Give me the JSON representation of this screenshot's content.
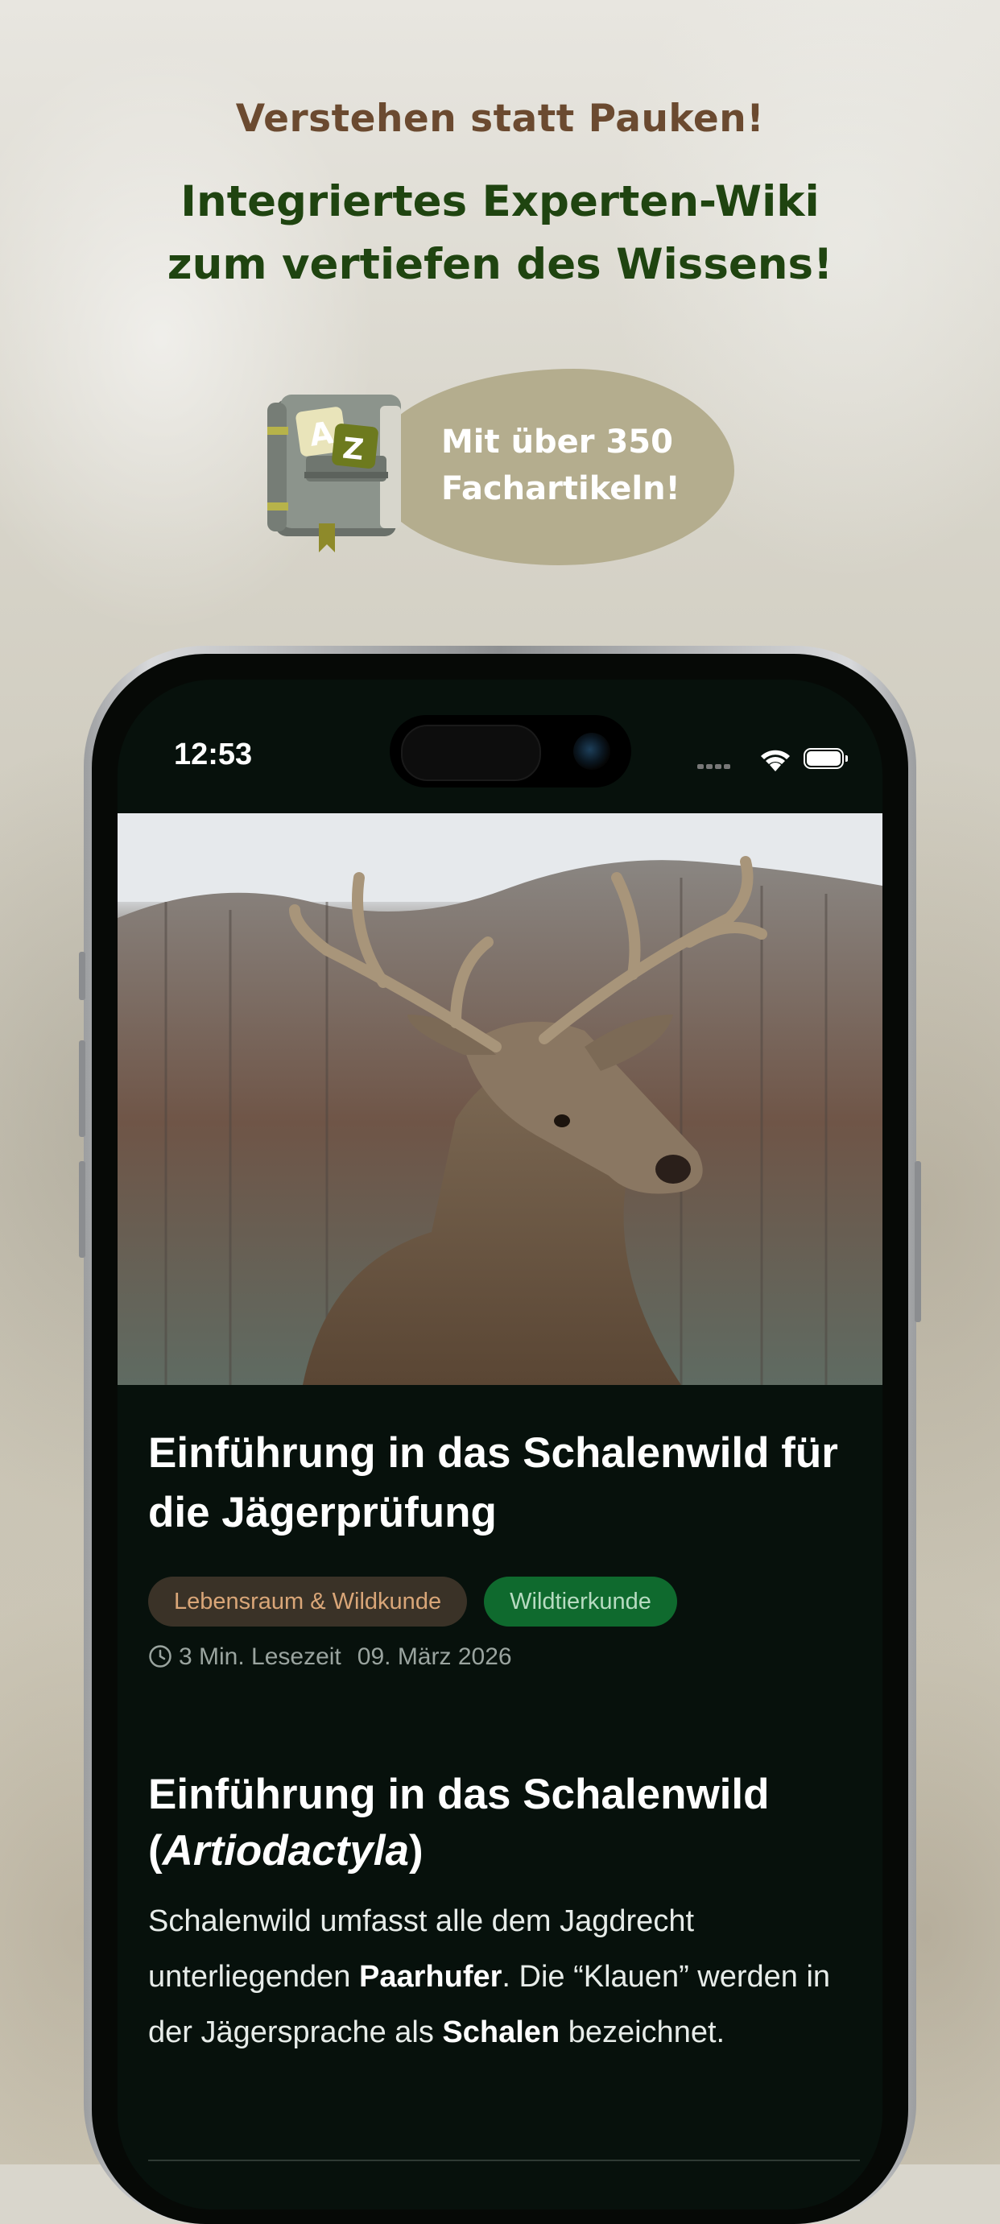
{
  "promo": {
    "subtitle": "Verstehen statt Pauken!",
    "title_line1": "Integriertes Experten-Wiki",
    "title_line2": "zum vertiefen des Wissens!",
    "bubble_line1": "Mit über 350",
    "bubble_line2": "Fachartikeln!",
    "book_letter_a": "A",
    "book_letter_z": "Z"
  },
  "status_bar": {
    "time": "12:53"
  },
  "article": {
    "title": "Einführung in das Schalenwild für die Jägerprüfung",
    "tags": [
      {
        "label": "Lebensraum & Wildkunde"
      },
      {
        "label": "Wildtierkunde"
      }
    ],
    "reading_time": "3 Min. Lesezeit",
    "date": "09. März 2026",
    "section": {
      "title_prefix": "Einführung in das Schalenwild",
      "title_paren_open": "(",
      "title_latin": "Artiodactyla",
      "title_paren_close": ")",
      "body_1": "Schalenwild umfasst alle dem Jagdrecht unterliegenden ",
      "body_bold_1": "Paarhufer",
      "body_2": ". Die “Klauen” werden in der Jägersprache als ",
      "body_bold_2": "Schalen",
      "body_3": " bezeichnet."
    }
  },
  "colors": {
    "subtitle": "#6b4a30",
    "title": "#1f4410",
    "bubble": "#b4ad8e",
    "screen_bg": "#07110c",
    "tag_habitat_bg": "#3a3227",
    "tag_wildlife_bg": "#0f6a2e"
  }
}
